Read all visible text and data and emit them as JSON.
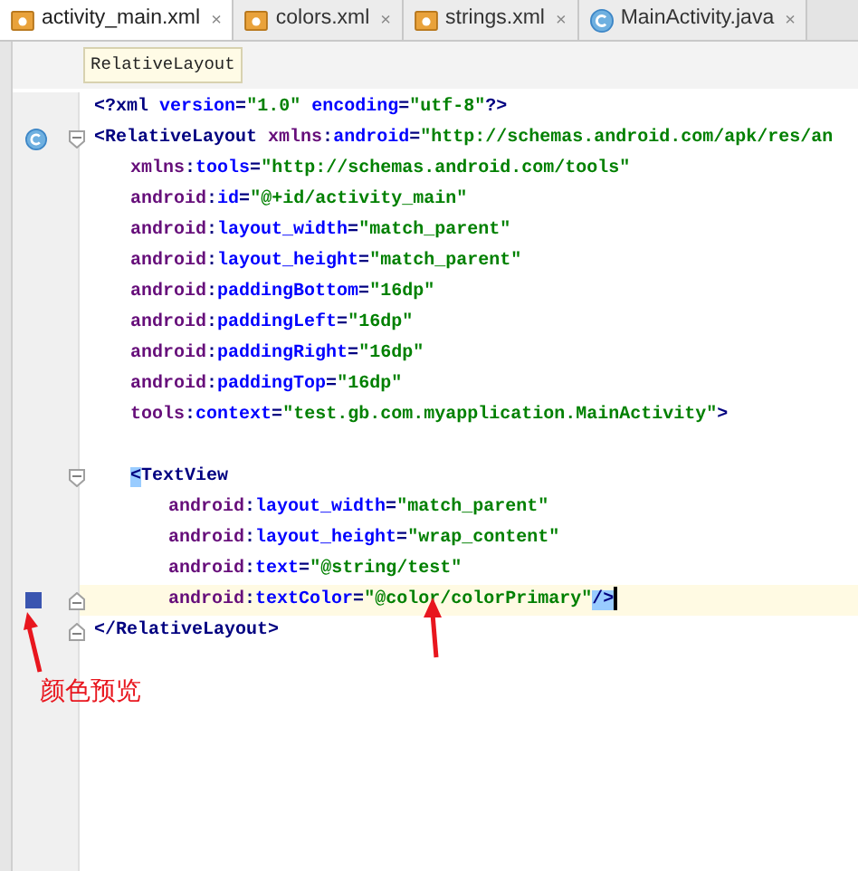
{
  "tabs": [
    {
      "label": "activity_main.xml",
      "kind": "xml",
      "selected": true,
      "close": "×"
    },
    {
      "label": "colors.xml",
      "kind": "xml",
      "selected": false,
      "close": "×"
    },
    {
      "label": "strings.xml",
      "kind": "xml",
      "selected": false,
      "close": "×"
    },
    {
      "label": "MainActivity.java",
      "kind": "class",
      "selected": false,
      "close": "×"
    }
  ],
  "breadcrumb": {
    "label": "RelativeLayout"
  },
  "editor": {
    "lines": [
      {
        "kind": "prolog",
        "current": false,
        "tokens": [
          {
            "kind": "punct",
            "text": "<?"
          },
          {
            "kind": "tag",
            "text": "xml "
          },
          {
            "kind": "attr",
            "text": "version"
          },
          {
            "kind": "punct",
            "text": "="
          },
          {
            "kind": "value",
            "text": "\"1.0\" "
          },
          {
            "kind": "attr",
            "text": "encoding"
          },
          {
            "kind": "punct",
            "text": "="
          },
          {
            "kind": "value",
            "text": "\"utf-8\""
          },
          {
            "kind": "punct",
            "text": "?>"
          }
        ]
      },
      {
        "kind": "root_tag",
        "current": false,
        "tokens": [
          {
            "kind": "punct",
            "text": "<"
          },
          {
            "kind": "tag",
            "text": "RelativeLayout "
          },
          {
            "kind": "ns",
            "text": "xmlns"
          },
          {
            "kind": "punct",
            "text": ":"
          },
          {
            "kind": "attr",
            "text": "android"
          },
          {
            "kind": "punct",
            "text": "="
          },
          {
            "kind": "value",
            "text": "\"http://schemas.android.com/apk/res/an"
          }
        ],
        "children": [
          {
            "kind": "attribute",
            "current": false,
            "tokens": [
              {
                "kind": "ns",
                "text": "xmlns"
              },
              {
                "kind": "punct",
                "text": ":"
              },
              {
                "kind": "attr",
                "text": "tools"
              },
              {
                "kind": "punct",
                "text": "="
              },
              {
                "kind": "value",
                "text": "\"http://schemas.android.com/tools\""
              }
            ]
          },
          {
            "kind": "attribute",
            "current": false,
            "tokens": [
              {
                "kind": "ns",
                "text": "android"
              },
              {
                "kind": "punct",
                "text": ":"
              },
              {
                "kind": "attr",
                "text": "id"
              },
              {
                "kind": "punct",
                "text": "="
              },
              {
                "kind": "value",
                "text": "\"@+id/activity_main\""
              }
            ]
          },
          {
            "kind": "attribute",
            "current": false,
            "tokens": [
              {
                "kind": "ns",
                "text": "android"
              },
              {
                "kind": "punct",
                "text": ":"
              },
              {
                "kind": "attr",
                "text": "layout_width"
              },
              {
                "kind": "punct",
                "text": "="
              },
              {
                "kind": "value",
                "text": "\"match_parent\""
              }
            ]
          },
          {
            "kind": "attribute",
            "current": false,
            "tokens": [
              {
                "kind": "ns",
                "text": "android"
              },
              {
                "kind": "punct",
                "text": ":"
              },
              {
                "kind": "attr",
                "text": "layout_height"
              },
              {
                "kind": "punct",
                "text": "="
              },
              {
                "kind": "value",
                "text": "\"match_parent\""
              }
            ]
          },
          {
            "kind": "attribute",
            "current": false,
            "tokens": [
              {
                "kind": "ns",
                "text": "android"
              },
              {
                "kind": "punct",
                "text": ":"
              },
              {
                "kind": "attr",
                "text": "paddingBottom"
              },
              {
                "kind": "punct",
                "text": "="
              },
              {
                "kind": "value",
                "text": "\"16dp\""
              }
            ]
          },
          {
            "kind": "attribute",
            "current": false,
            "tokens": [
              {
                "kind": "ns",
                "text": "android"
              },
              {
                "kind": "punct",
                "text": ":"
              },
              {
                "kind": "attr",
                "text": "paddingLeft"
              },
              {
                "kind": "punct",
                "text": "="
              },
              {
                "kind": "value",
                "text": "\"16dp\""
              }
            ]
          },
          {
            "kind": "attribute",
            "current": false,
            "tokens": [
              {
                "kind": "ns",
                "text": "android"
              },
              {
                "kind": "punct",
                "text": ":"
              },
              {
                "kind": "attr",
                "text": "paddingRight"
              },
              {
                "kind": "punct",
                "text": "="
              },
              {
                "kind": "value",
                "text": "\"16dp\""
              }
            ]
          },
          {
            "kind": "attribute",
            "current": false,
            "tokens": [
              {
                "kind": "ns",
                "text": "android"
              },
              {
                "kind": "punct",
                "text": ":"
              },
              {
                "kind": "attr",
                "text": "paddingTop"
              },
              {
                "kind": "punct",
                "text": "="
              },
              {
                "kind": "value",
                "text": "\"16dp\""
              }
            ]
          },
          {
            "kind": "attribute",
            "current": false,
            "tokens": [
              {
                "kind": "ns",
                "text": "tools"
              },
              {
                "kind": "punct",
                "text": ":"
              },
              {
                "kind": "attr",
                "text": "context"
              },
              {
                "kind": "punct",
                "text": "="
              },
              {
                "kind": "value",
                "text": "\"test.gb.com.myapplication.MainActivity\""
              },
              {
                "kind": "punct",
                "text": ">"
              }
            ]
          },
          {
            "kind": "blank",
            "current": false
          },
          {
            "kind": "open_tag",
            "current": false,
            "tokens": [
              {
                "kind": "match",
                "text": "<"
              },
              {
                "kind": "tag",
                "text": "TextView"
              }
            ],
            "children": [
              {
                "kind": "attribute",
                "current": false,
                "tokens": [
                  {
                    "kind": "ns",
                    "text": "android"
                  },
                  {
                    "kind": "punct",
                    "text": ":"
                  },
                  {
                    "kind": "attr",
                    "text": "layout_width"
                  },
                  {
                    "kind": "punct",
                    "text": "="
                  },
                  {
                    "kind": "value",
                    "text": "\"match_parent\""
                  }
                ]
              },
              {
                "kind": "attribute",
                "current": false,
                "tokens": [
                  {
                    "kind": "ns",
                    "text": "android"
                  },
                  {
                    "kind": "punct",
                    "text": ":"
                  },
                  {
                    "kind": "attr",
                    "text": "layout_height"
                  },
                  {
                    "kind": "punct",
                    "text": "="
                  },
                  {
                    "kind": "value",
                    "text": "\"wrap_content\""
                  }
                ]
              },
              {
                "kind": "attribute",
                "current": false,
                "tokens": [
                  {
                    "kind": "ns",
                    "text": "android"
                  },
                  {
                    "kind": "punct",
                    "text": ":"
                  },
                  {
                    "kind": "attr",
                    "text": "text"
                  },
                  {
                    "kind": "punct",
                    "text": "="
                  },
                  {
                    "kind": "value",
                    "text": "\"@string/test\""
                  }
                ]
              },
              {
                "kind": "closing",
                "current": true,
                "color": "#3a55b0",
                "tokens": [
                  {
                    "kind": "ns",
                    "text": "android"
                  },
                  {
                    "kind": "punct",
                    "text": ":"
                  },
                  {
                    "kind": "attr",
                    "text": "textColor"
                  },
                  {
                    "kind": "punct",
                    "text": "="
                  },
                  {
                    "kind": "value",
                    "text": "\"@color/colorPrimary\""
                  },
                  {
                    "kind": "match",
                    "text": "/>"
                  }
                ]
              }
            ]
          }
        ]
      },
      {
        "kind": "closing",
        "current": false,
        "tokens": [
          {
            "kind": "punct",
            "text": "</"
          },
          {
            "kind": "tag",
            "text": "RelativeLayout"
          },
          {
            "kind": "punct",
            "text": ">"
          }
        ]
      }
    ]
  },
  "annotation": {
    "label": "颜色预览"
  }
}
